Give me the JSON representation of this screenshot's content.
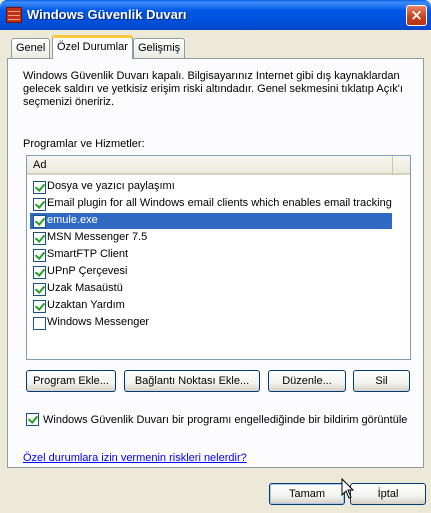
{
  "window": {
    "title": "Windows Güvenlik Duvarı",
    "close_glyph": "×"
  },
  "tabs": [
    {
      "label": "Genel",
      "active": false
    },
    {
      "label": "Özel Durumlar",
      "active": true
    },
    {
      "label": "Gelişmiş",
      "active": false
    }
  ],
  "info_text": "Windows Güvenlik Duvarı kapalı. Bilgisayarınız Internet gibi dış kaynaklardan gelecek saldırı ve yetkisiz erişim riski altındadır. Genel sekmesini tıklatıp Açık'ı seçmenizi öneririz.",
  "list": {
    "label": "Programlar ve Hizmetler:",
    "column_header": "Ad",
    "items": [
      {
        "label": "Dosya ve yazıcı paylaşımı",
        "checked": true,
        "selected": false
      },
      {
        "label": "Email plugin for all Windows email clients which enables email tracking,...",
        "checked": true,
        "selected": false
      },
      {
        "label": "emule.exe",
        "checked": true,
        "selected": true
      },
      {
        "label": "MSN Messenger 7.5",
        "checked": true,
        "selected": false
      },
      {
        "label": "SmartFTP Client",
        "checked": true,
        "selected": false
      },
      {
        "label": "UPnP Çerçevesi",
        "checked": true,
        "selected": false
      },
      {
        "label": "Uzak Masaüstü",
        "checked": true,
        "selected": false
      },
      {
        "label": "Uzaktan Yardım",
        "checked": true,
        "selected": false
      },
      {
        "label": "Windows Messenger",
        "checked": false,
        "selected": false
      }
    ]
  },
  "buttons": {
    "add_program": "Program Ekle...",
    "add_port": "Bağlantı Noktası Ekle...",
    "edit": "Düzenle...",
    "delete": "Sil",
    "ok": "Tamam",
    "cancel": "İptal"
  },
  "notify": {
    "label": "Windows Güvenlik Duvarı bir programı engellediğinde bir bildirim görüntüle",
    "checked": true
  },
  "risk_link": "Özel durumlara izin vermenin riskleri nelerdir?",
  "colors": {
    "titlebar": "#0054e3",
    "selection": "#316ac5",
    "tab_highlight": "#ffc83c",
    "link": "#0000ff"
  }
}
